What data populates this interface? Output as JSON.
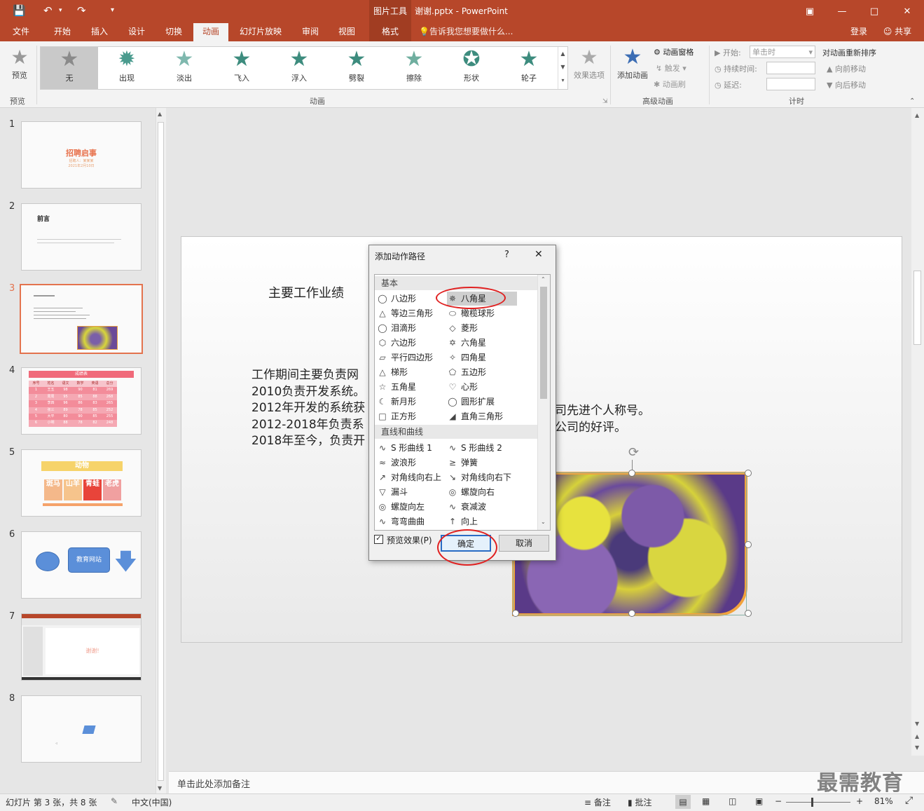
{
  "titlebar": {
    "context_tab": "图片工具",
    "doc_title": "谢谢.pptx - PowerPoint",
    "save_icon": "save-icon",
    "undo_icon": "undo-icon",
    "redo_icon": "redo-icon",
    "window_buttons": [
      "restore-ribbon-icon",
      "minimize-icon",
      "maximize-icon",
      "close-icon"
    ],
    "accent": "#b7472a"
  },
  "menu": {
    "tabs": [
      "文件",
      "开始",
      "插入",
      "设计",
      "切换",
      "动画",
      "幻灯片放映",
      "审阅",
      "视图",
      "格式"
    ],
    "active": "动画",
    "tell_me": "告诉我您想要做什么...",
    "login": "登录",
    "share": "共享"
  },
  "ribbon": {
    "preview_label": "预览",
    "preview_group": "预览",
    "gallery": [
      "无",
      "出现",
      "淡出",
      "飞入",
      "浮入",
      "劈裂",
      "擦除",
      "形状",
      "轮子"
    ],
    "effect_options": "效果选项",
    "animation_group": "动画",
    "add_animation": "添加动画",
    "animation_pane": "动画窗格",
    "trigger": "触发",
    "animation_painter": "动画刷",
    "advanced_group": "高级动画",
    "start_label": "开始:",
    "start_value": "单击时",
    "duration_label": "持续时间:",
    "delay_label": "延迟:",
    "reorder_title": "对动画重新排序",
    "move_earlier": "向前移动",
    "move_later": "向后移动",
    "timing_group": "计时"
  },
  "slides": {
    "numbers": [
      "1",
      "2",
      "3",
      "4",
      "5",
      "6",
      "7",
      "8"
    ],
    "s1_title": "招聘启事",
    "s1_sub1": "招聘人：某某某",
    "s1_sub2": "2021年2月10日",
    "s2_title": "前言",
    "s4_title": "成绩表",
    "s4_headers": [
      "序号",
      "姓名",
      "语文",
      "数学",
      "英语",
      "总分"
    ],
    "s4_rows": [
      [
        "1",
        "王五",
        "98",
        "90",
        "81",
        "269"
      ],
      [
        "2",
        "周周",
        "95",
        "85",
        "88",
        "268"
      ],
      [
        "3",
        "李四",
        "96",
        "86",
        "83",
        "265"
      ],
      [
        "4",
        "张三",
        "89",
        "78",
        "85",
        "252"
      ],
      [
        "5",
        "大平",
        "80",
        "90",
        "85",
        "255"
      ],
      [
        "6",
        "小明",
        "88",
        "78",
        "82",
        "248"
      ]
    ],
    "s5_title": "动物",
    "s5_items": [
      "斑马",
      "山羊",
      "青蛙",
      "老虎"
    ],
    "s6_box": "教育网站",
    "s7_text": "谢谢!"
  },
  "slide": {
    "heading": "主要工作业绩",
    "lines": [
      "工作期间主要负责网",
      "2010负责开发系统。",
      "2012年开发的系统获",
      "2012-2018年负责系",
      "2018年至今，负责开"
    ],
    "line_tails": [
      "司先进个人称号。",
      "公司的好评。"
    ]
  },
  "dialog": {
    "title": "添加动作路径",
    "help": "?",
    "close": "✕",
    "section_basic": "基本",
    "basic_left": [
      "八边形",
      "等边三角形",
      "泪滴形",
      "六边形",
      "平行四边形",
      "梯形",
      "五角星",
      "新月形",
      "正方形"
    ],
    "basic_right": [
      "八角星",
      "橄榄球形",
      "菱形",
      "六角星",
      "四角星",
      "五边形",
      "心形",
      "圆形扩展",
      "直角三角形"
    ],
    "section_lines": "直线和曲线",
    "lines_left": [
      "S 形曲线 1",
      "波浪形",
      "对角线向右上",
      "漏斗",
      "螺旋向左",
      "弯弯曲曲"
    ],
    "lines_right": [
      "S 形曲线 2",
      "弹簧",
      "对角线向右下",
      "螺旋向右",
      "衰减波",
      "向上"
    ],
    "selected": "八角星",
    "preview_checkbox": "预览效果(P)",
    "ok": "确定",
    "cancel": "取消"
  },
  "notes": {
    "placeholder": "单击此处添加备注"
  },
  "status": {
    "slide_info": "幻灯片 第 3 张，共 8 张",
    "language": "中文(中国)",
    "notes_btn": "备注",
    "comments_btn": "批注",
    "zoom": "81%"
  },
  "watermark": "最需教育"
}
